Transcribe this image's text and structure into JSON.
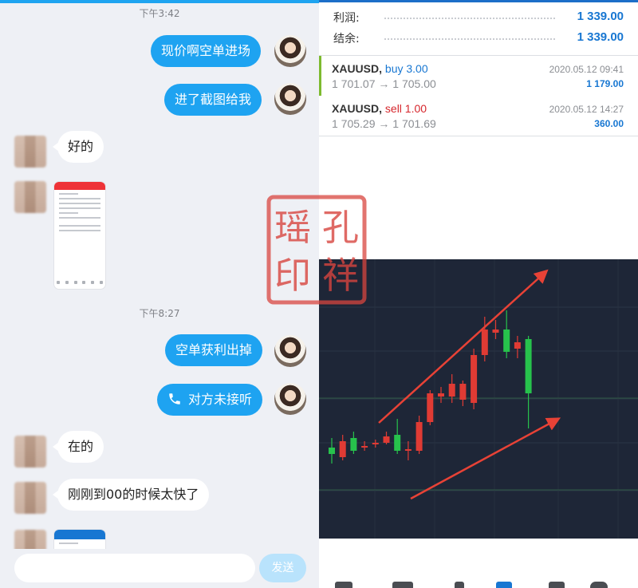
{
  "chat": {
    "timestamps": [
      "下午3:42",
      "下午8:27"
    ],
    "messages": {
      "m1": "现价啊空单进场",
      "m2": "进了截图给我",
      "m3": "好的",
      "m4": "空单获利出掉",
      "m5": "对方未接听",
      "m6": "在的",
      "m7": "刚刚到00的时候太快了"
    },
    "send_label": "发送",
    "colors": {
      "bubble_out": "#1ea3f1",
      "accent": "#1ea4f0"
    }
  },
  "seal": {
    "text": [
      "瑶",
      "孔",
      "印",
      "祥"
    ],
    "color": "#d8453f"
  },
  "trade": {
    "summary": [
      {
        "label": "利润:",
        "value": "1 339.00"
      },
      {
        "label": "结余:",
        "value": "1 339.00"
      }
    ],
    "positions": [
      {
        "symbol": "XAUUSD,",
        "side": "buy 3.00",
        "prices": "1 701.07 → 1 705.00",
        "datetime": "2020.05.12 09:41",
        "profit": "1 179.00"
      },
      {
        "symbol": "XAUUSD,",
        "side": "sell 1.00",
        "prices": "1 705.29 → 1 701.69",
        "datetime": "2020.05.12 14:27",
        "profit": "360.00"
      }
    ],
    "colors": {
      "profit": "#1877d2",
      "sell": "#d6262c",
      "buy_accent": "#7dba2f"
    }
  },
  "chart_data": {
    "type": "candlestick",
    "colors": {
      "up": "#e03b34",
      "down": "#27c24c",
      "arrow": "#e84236",
      "background": "#1e2637"
    },
    "candles": [
      {
        "o": 1.6,
        "c": 1.4,
        "h": 1.9,
        "l": 1.1
      },
      {
        "o": 1.3,
        "c": 1.8,
        "h": 2.0,
        "l": 1.2
      },
      {
        "o": 1.9,
        "c": 1.5,
        "h": 2.1,
        "l": 1.4
      },
      {
        "o": 1.6,
        "c": 1.65,
        "h": 1.8,
        "l": 1.5
      },
      {
        "o": 1.7,
        "c": 1.75,
        "h": 1.85,
        "l": 1.6
      },
      {
        "o": 1.75,
        "c": 1.95,
        "h": 2.1,
        "l": 1.7
      },
      {
        "o": 2.0,
        "c": 1.5,
        "h": 2.5,
        "l": 1.4
      },
      {
        "o": 1.5,
        "c": 1.55,
        "h": 1.8,
        "l": 1.2
      },
      {
        "o": 1.5,
        "c": 2.4,
        "h": 2.6,
        "l": 1.4
      },
      {
        "o": 2.4,
        "c": 3.3,
        "h": 3.4,
        "l": 2.3
      },
      {
        "o": 3.2,
        "c": 3.3,
        "h": 3.5,
        "l": 3.0
      },
      {
        "o": 3.2,
        "c": 3.6,
        "h": 3.9,
        "l": 3.0
      },
      {
        "o": 3.1,
        "c": 3.6,
        "h": 3.7,
        "l": 2.9
      },
      {
        "o": 3.0,
        "c": 4.5,
        "h": 4.7,
        "l": 2.8
      },
      {
        "o": 4.5,
        "c": 5.3,
        "h": 5.7,
        "l": 4.3
      },
      {
        "o": 5.2,
        "c": 5.3,
        "h": 5.6,
        "l": 5.0
      },
      {
        "o": 5.3,
        "c": 4.6,
        "h": 5.9,
        "l": 4.4
      },
      {
        "o": 4.7,
        "c": 4.9,
        "h": 5.1,
        "l": 4.4
      },
      {
        "o": 5.0,
        "c": 3.3,
        "h": 5.1,
        "l": 2.2
      }
    ]
  }
}
